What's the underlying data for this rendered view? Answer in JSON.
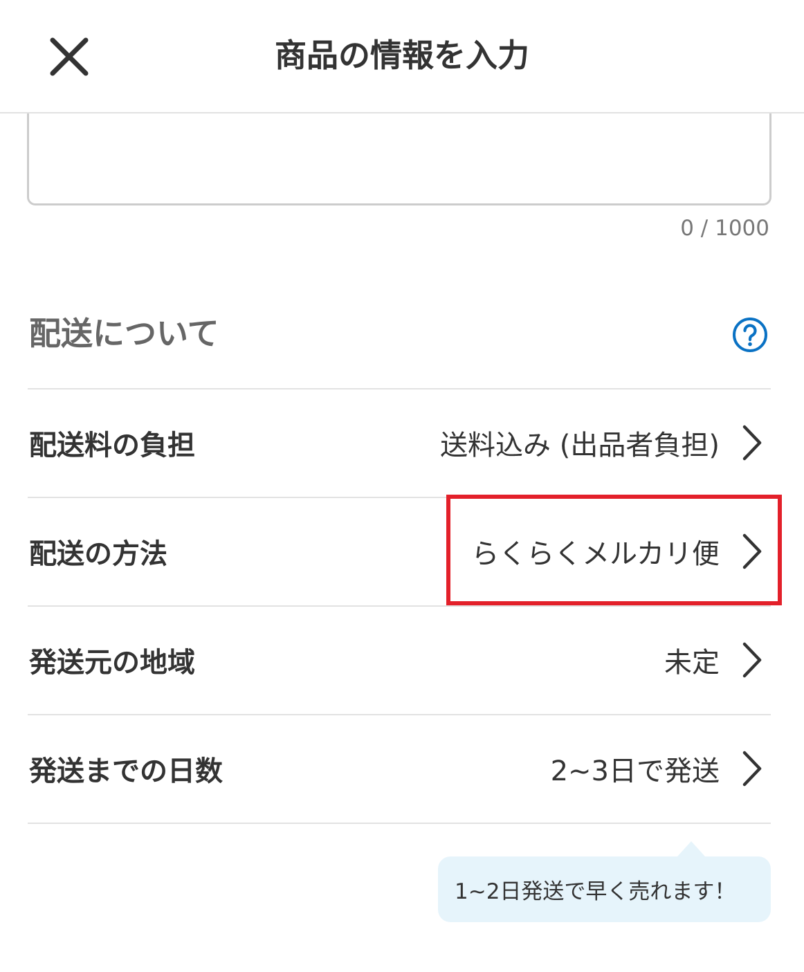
{
  "header": {
    "title": "商品の情報を入力",
    "close_icon": "close-icon"
  },
  "description": {
    "value": "",
    "char_count": "0 / 1000"
  },
  "shipping": {
    "section_title": "配送について",
    "help_icon": "question-circle-icon",
    "rows": [
      {
        "label": "配送料の負担",
        "value": "送料込み (出品者負担)"
      },
      {
        "label": "配送の方法",
        "value": "らくらくメルカリ便"
      },
      {
        "label": "発送元の地域",
        "value": "未定"
      },
      {
        "label": "発送までの日数",
        "value": "2~3日で発送"
      }
    ],
    "tooltip": "1~2日発送で早く売れます！"
  },
  "colors": {
    "accent": "#0a72c4",
    "highlight": "#e3202a",
    "tooltip_bg": "#e6f4fb"
  }
}
